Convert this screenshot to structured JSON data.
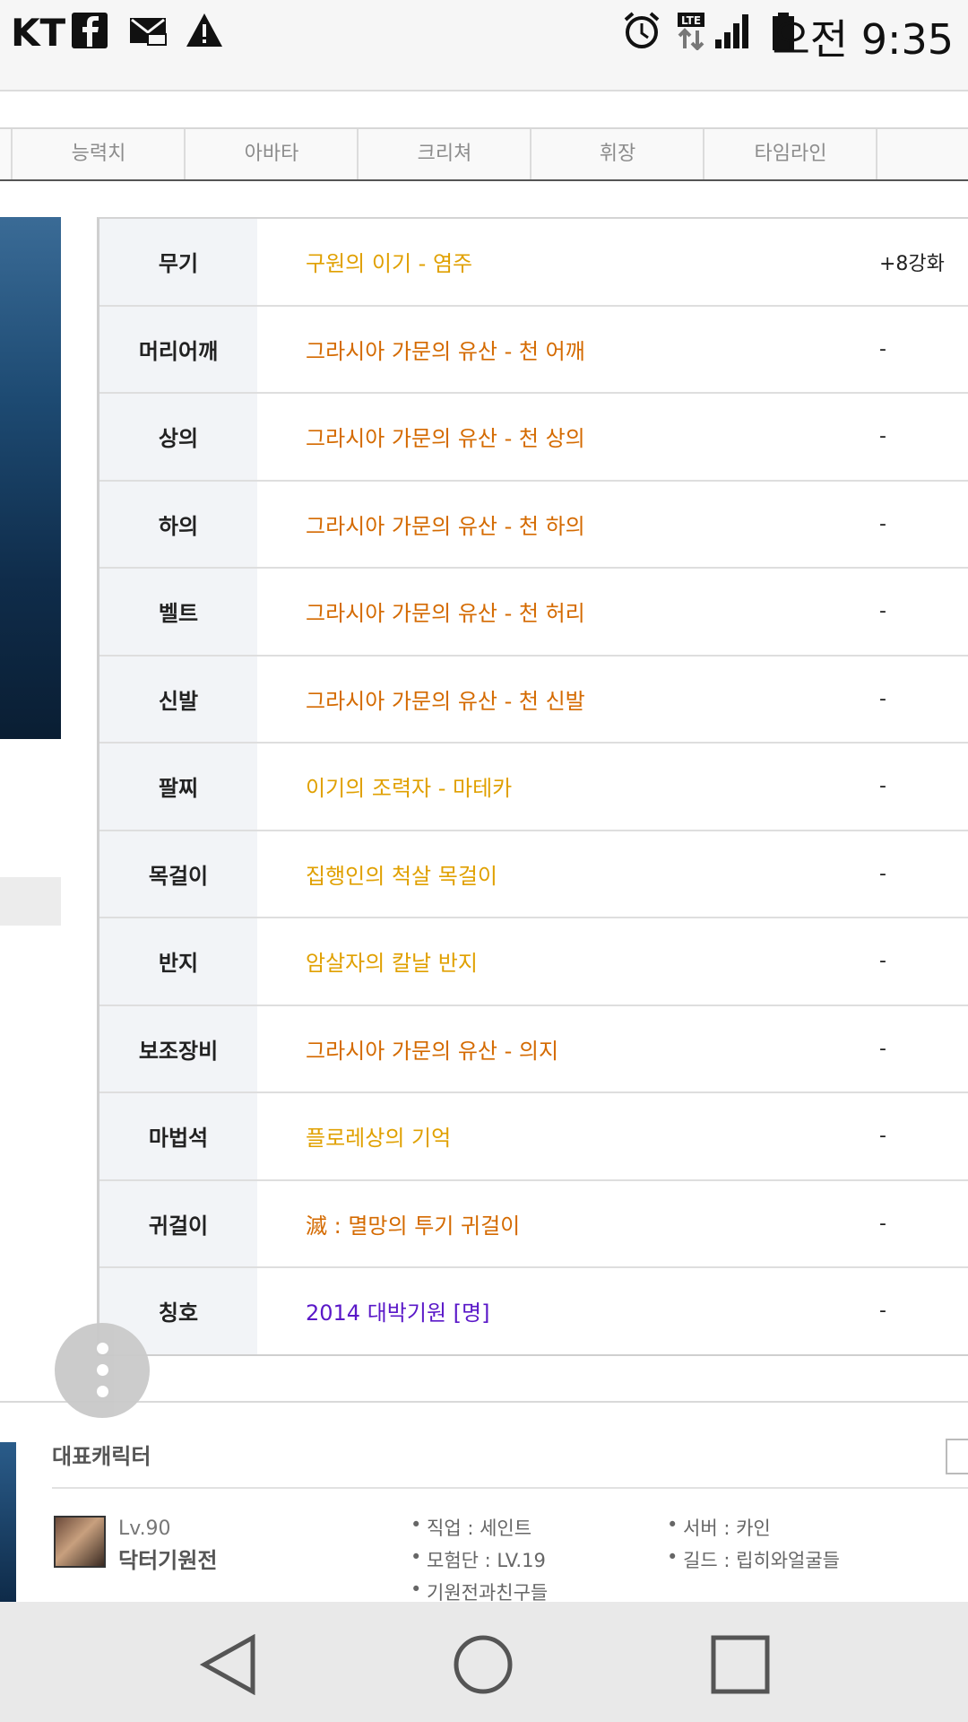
{
  "statusbar": {
    "carrier": "KT",
    "icons": [
      "facebook-icon",
      "mail-icon",
      "warning-icon",
      "alarm-icon",
      "lte-icon",
      "signal-icon",
      "battery-icon"
    ],
    "time": "오전 9:35"
  },
  "tabs": [
    "능력치",
    "아바타",
    "크리쳐",
    "휘장",
    "타임라인"
  ],
  "equipment": [
    {
      "slot": "무기",
      "item": "구원의 이기 - 염주",
      "enhance": "+8강화",
      "color": "#e0a000"
    },
    {
      "slot": "머리어깨",
      "item": "그라시아 가문의 유산 - 천 어깨",
      "enhance": "-",
      "color": "#d46a00"
    },
    {
      "slot": "상의",
      "item": "그라시아 가문의 유산 - 천 상의",
      "enhance": "-",
      "color": "#d46a00"
    },
    {
      "slot": "하의",
      "item": "그라시아 가문의 유산 - 천 하의",
      "enhance": "-",
      "color": "#d46a00"
    },
    {
      "slot": "벨트",
      "item": "그라시아 가문의 유산 - 천 허리",
      "enhance": "-",
      "color": "#d46a00"
    },
    {
      "slot": "신발",
      "item": "그라시아 가문의 유산 - 천 신발",
      "enhance": "-",
      "color": "#d46a00"
    },
    {
      "slot": "팔찌",
      "item": "이기의 조력자 - 마테카",
      "enhance": "-",
      "color": "#e0a000"
    },
    {
      "slot": "목걸이",
      "item": "집행인의 척살 목걸이",
      "enhance": "-",
      "color": "#e0a000"
    },
    {
      "slot": "반지",
      "item": "암살자의 칼날 반지",
      "enhance": "-",
      "color": "#e0a000"
    },
    {
      "slot": "보조장비",
      "item": "그라시아 가문의 유산 - 의지",
      "enhance": "-",
      "color": "#d46a00"
    },
    {
      "slot": "마법석",
      "item": "플로레상의 기억",
      "enhance": "-",
      "color": "#e0a000"
    },
    {
      "slot": "귀걸이",
      "item": "滅 : 멸망의 투기 귀걸이",
      "enhance": "-",
      "color": "#d46a00"
    },
    {
      "slot": "칭호",
      "item": "2014 대박기원 [명]",
      "enhance": "-",
      "color": "#5a18c8"
    }
  ],
  "representative": {
    "title": "대표캐릭터",
    "level": "Lv.90",
    "name": "닥터기원전",
    "job": "직업 : 세인트",
    "adventure": "모험단 : LV.19",
    "adventure_name": "기원전과친구들",
    "server": "서버 : 카인",
    "guild": "길드 : 립히와얼굴들"
  },
  "navbar": [
    "back-icon",
    "home-icon",
    "recents-icon"
  ]
}
